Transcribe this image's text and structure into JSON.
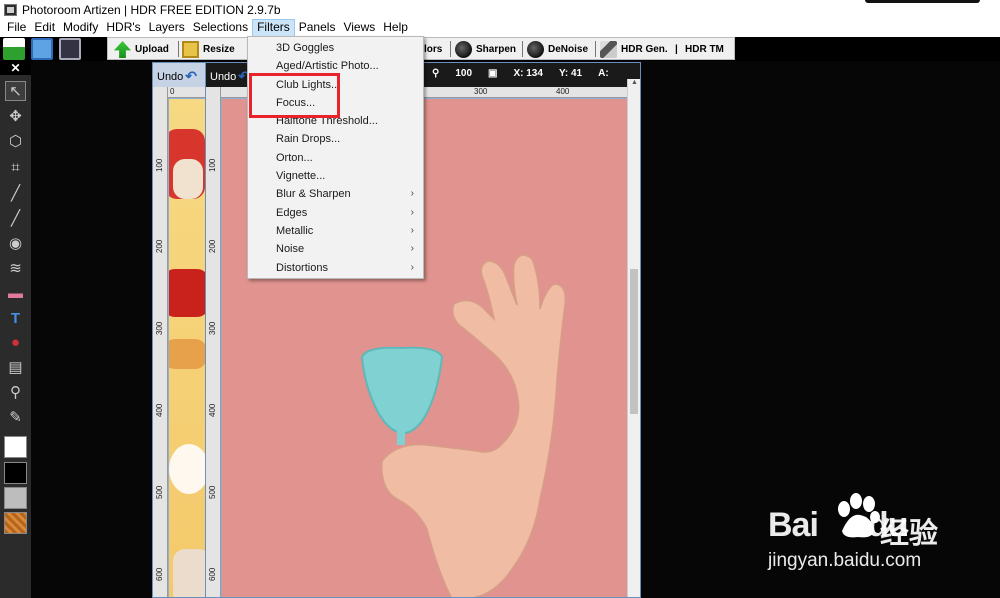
{
  "window": {
    "title": "Photoroom Artizen | HDR FREE EDITION 2.9.7b"
  },
  "menubar": {
    "items": [
      "File",
      "Edit",
      "Modify",
      "HDR's",
      "Layers",
      "Selections",
      "Filters",
      "Panels",
      "Views",
      "Help"
    ],
    "active": "Filters"
  },
  "toolbar": {
    "upload": "Upload",
    "resize": "Resize",
    "colors": "lors",
    "sharpen": "Sharpen",
    "denoise": "DeNoise",
    "hdr_gen": "HDR Gen.",
    "hdr_sep": "|",
    "hdr_tm": "HDR TM"
  },
  "toolpanel": {
    "close": "✕"
  },
  "doc1": {
    "undo": "Undo",
    "ruler_h_0": "0",
    "ruler_v": [
      "100",
      "200",
      "300",
      "400",
      "500",
      "600"
    ]
  },
  "doc2": {
    "undo": "Undo",
    "zoom": "100",
    "x_label": "X: 134",
    "y_label": "Y: 41",
    "a_label": "A:",
    "ruler_h": [
      "300",
      "400"
    ],
    "ruler_v": [
      "100",
      "200",
      "300",
      "400",
      "500",
      "600"
    ]
  },
  "filters_menu": {
    "items": [
      {
        "label": "3D Goggles",
        "submenu": false
      },
      {
        "label": "Aged/Artistic Photo...",
        "submenu": false
      },
      {
        "label": "Club Lights...",
        "submenu": false
      },
      {
        "label": "Focus...",
        "submenu": false
      },
      {
        "label": "Halftone Threshold...",
        "submenu": false
      },
      {
        "label": "Rain Drops...",
        "submenu": false
      },
      {
        "label": "Orton...",
        "submenu": false
      },
      {
        "label": "Vignette...",
        "submenu": false
      },
      {
        "label": "Blur & Sharpen",
        "submenu": true
      },
      {
        "label": "Edges",
        "submenu": true
      },
      {
        "label": "Metallic",
        "submenu": true
      },
      {
        "label": "Noise",
        "submenu": true
      },
      {
        "label": "Distortions",
        "submenu": true
      }
    ],
    "submenu_arrow": "›"
  },
  "watermark": {
    "brand": "Bai",
    "brand2": "du",
    "cn": "经验",
    "url": "jingyan.baidu.com"
  },
  "colors": {
    "highlight": "#e8232b",
    "menu_active": "#cce4f7",
    "canvas_bg": "#e0938f"
  }
}
